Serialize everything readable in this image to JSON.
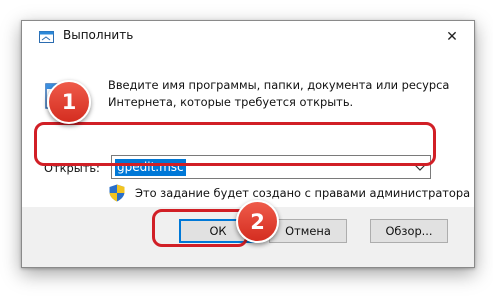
{
  "window": {
    "title": "Выполнить",
    "close_symbol": "✕"
  },
  "description": "Введите имя программы, папки, документа или ресурса Интернета, которые требуется открыть.",
  "open_field": {
    "label": "Открыть:",
    "value": "gpedit.msc"
  },
  "admin_note": "Это задание будет создано с правами администратора",
  "buttons": {
    "ok": "ОК",
    "cancel": "Отмена",
    "browse": "Обзор..."
  },
  "annotations": {
    "step1": "1",
    "step2": "2"
  },
  "colors": {
    "highlight": "#d11f26",
    "badge": "#e0402f",
    "selection": "#0078d7"
  },
  "icons": [
    "run-app-icon",
    "close-icon",
    "run-dialog-icon",
    "dropdown-arrow-icon",
    "uac-shield-icon"
  ]
}
